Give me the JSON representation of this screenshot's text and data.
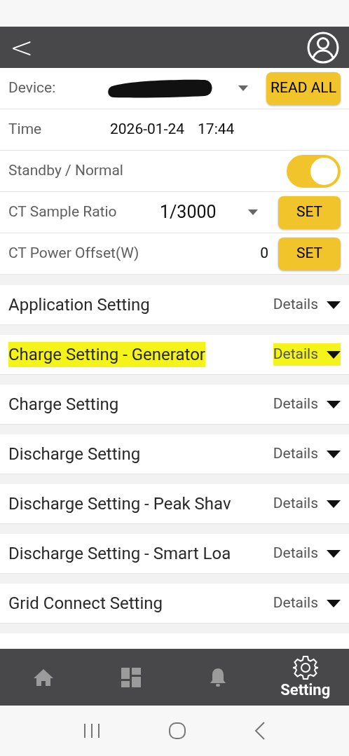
{
  "header": {
    "back": "<"
  },
  "device_row": {
    "label": "Device:",
    "redacted": true,
    "button": "READ ALL"
  },
  "time_row": {
    "label": "Time",
    "date": "2026-01-24",
    "time": "17:44"
  },
  "standby_row": {
    "label": "Standby / Normal",
    "on": true
  },
  "ct_ratio_row": {
    "label": "CT Sample Ratio",
    "value": "1/3000",
    "button": "SET"
  },
  "ct_offset_row": {
    "label": "CT Power Offset(W)",
    "value": "0",
    "button": "SET"
  },
  "sections": [
    {
      "title": "Application Setting",
      "action": "Details",
      "highlighted": false
    },
    {
      "title": "Charge Setting - Generator",
      "action": "Details",
      "highlighted": true
    },
    {
      "title": "Charge Setting",
      "action": "Details",
      "highlighted": false
    },
    {
      "title": "Discharge Setting",
      "action": "Details",
      "highlighted": false
    },
    {
      "title": "Discharge Setting - Peak Shav",
      "action": "Details",
      "highlighted": false
    },
    {
      "title": "Discharge Setting - Smart Loa",
      "action": "Details",
      "highlighted": false
    },
    {
      "title": "Grid Connect Setting",
      "action": "Details",
      "highlighted": false
    }
  ],
  "bottom_nav": [
    {
      "kind": "home",
      "selected": false
    },
    {
      "kind": "dashboard",
      "selected": false
    },
    {
      "kind": "bell",
      "selected": false
    },
    {
      "kind": "gear",
      "selected": true,
      "label": "Setting"
    }
  ]
}
